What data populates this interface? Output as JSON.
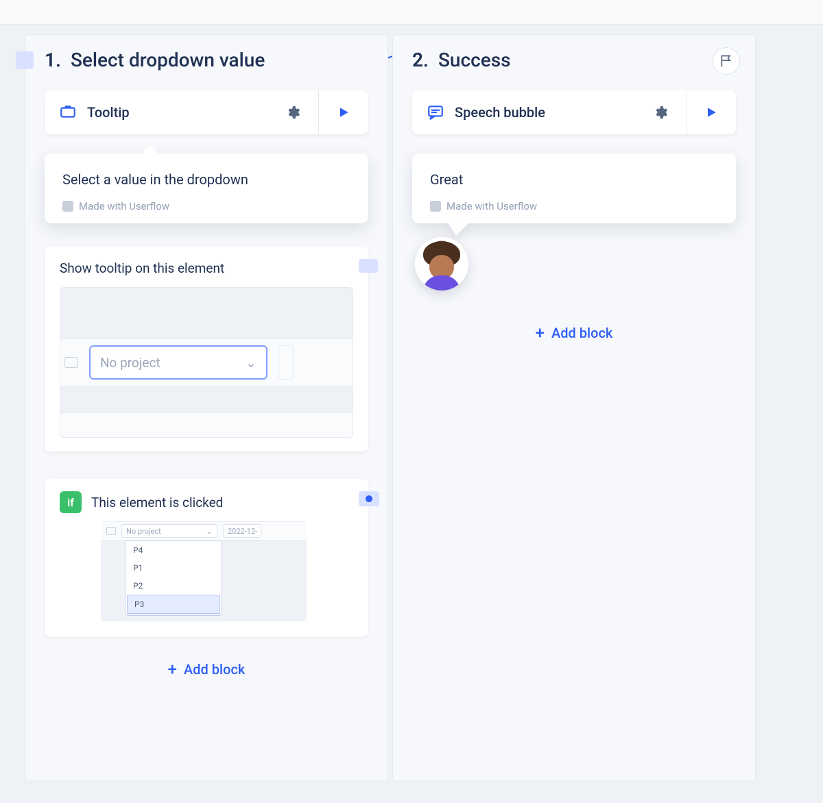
{
  "step1": {
    "number": "1.",
    "title": "Select dropdown value",
    "blockType": "Tooltip",
    "tooltipText": "Select a value in the dropdown",
    "madeWith": "Made with Userflow",
    "showElementTitle": "Show tooltip on this element",
    "dropdownValue": "No project",
    "trigger": {
      "badge": "if",
      "title": "This element is clicked",
      "miniDropdown": "No project",
      "dateCell": "2022-12-",
      "options": [
        "P4",
        "P1",
        "P2",
        "P3"
      ],
      "selectedIndex": 3
    },
    "addBlock": "Add block"
  },
  "step2": {
    "number": "2.",
    "title": "Success",
    "blockType": "Speech bubble",
    "bubbleText": "Great",
    "madeWith": "Made with Userflow",
    "addBlock": "Add block"
  }
}
